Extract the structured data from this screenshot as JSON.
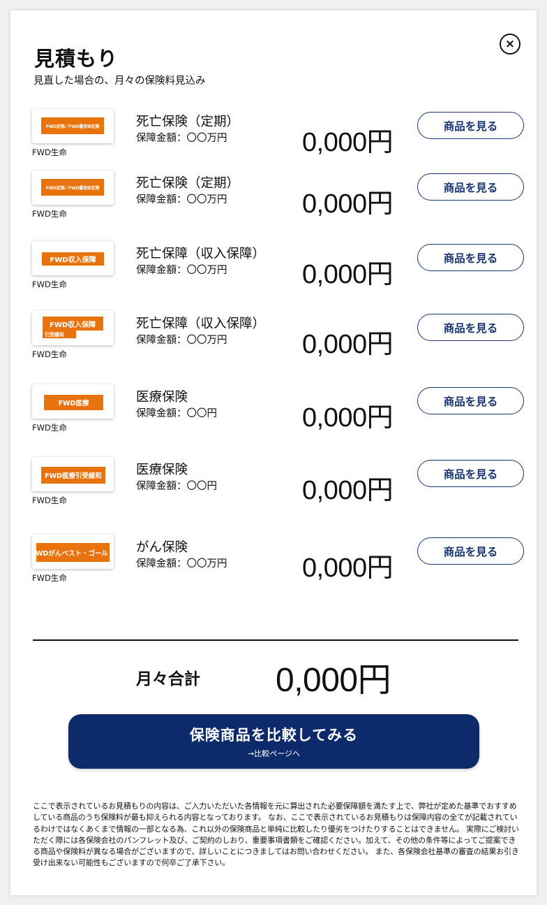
{
  "modal": {
    "title": "見積もり",
    "subtitle": "見直した場合の、月々の保険料見込み",
    "close_label": "×"
  },
  "items": [
    {
      "logo_text": "FWD定期／FWD優良体定期",
      "logo_sub": "",
      "company": "FWD生命",
      "product_name": "死亡保険（定期）",
      "coverage": "保障金額：〇〇万円",
      "price": "0,000円",
      "button_label": "商品を見る"
    },
    {
      "logo_text": "FWD定期／FWD優良体定期",
      "logo_sub": "",
      "company": "FWD生命",
      "product_name": "死亡保険（定期）",
      "coverage": "保障金額：〇〇万円",
      "price": "0,000円",
      "button_label": "商品を見る"
    },
    {
      "logo_text": "FWD収入保障",
      "logo_sub": "",
      "company": "FWD生命",
      "product_name": "死亡保障（収入保障）",
      "coverage": "保障金額：〇〇万円",
      "price": "0,000円",
      "button_label": "商品を見る"
    },
    {
      "logo_text": "FWD収入保障",
      "logo_sub": "引受緩和",
      "company": "FWD生命",
      "product_name": "死亡保障（収入保障）",
      "coverage": "保障金額：〇〇万円",
      "price": "0,000円",
      "button_label": "商品を見る"
    },
    {
      "logo_text": "FWD医療",
      "logo_sub": "",
      "company": "FWD生命",
      "product_name": "医療保険",
      "coverage": "保障金額：〇〇円",
      "price": "0,000円",
      "button_label": "商品を見る"
    },
    {
      "logo_text": "FWD医療引受緩和",
      "logo_sub": "",
      "company": "FWD生命",
      "product_name": "医療保険",
      "coverage": "保障金額：〇〇円",
      "price": "0,000円",
      "button_label": "商品を見る"
    },
    {
      "logo_text": "FWDがんベスト・ゴールド",
      "logo_sub": "",
      "company": "FWD生命",
      "product_name": "がん保険",
      "coverage": "保障金額：〇〇万円",
      "price": "0,000円",
      "button_label": "商品を見る"
    }
  ],
  "total": {
    "label": "月々合計",
    "value": "0,000円"
  },
  "compare_button": {
    "label": "保険商品を比較してみる",
    "sub_label": "→比較ページへ"
  },
  "disclaimer": "ここで表示されているお見積もりの内容は、ご入力いただいた各情報を元に算出された必要保障額を満たす上で、弊社が定めた基準でおすすめしている商品のうち保険料が最も抑えられる内容となっております。 なお、ここで表示されているお見積もりは保障内容の全てが記載されているわけではなくあくまで情報の一部となる為、これ以外の保険商品と単純に比較したり優劣をつけたりすることはできません。 実際にご検討いただく際には各保険会社のパンフレット及び、ご契約のしおり、重要事項書類をご確認ください。加えて、その他の条件等によってご提案できる商品や保険料が異なる場合がございますので、詳しいことにつきましてはお問い合わせください。 また、各保険会社基準の審査の結果お引き受け出来ない可能性もございますので何卒ご了承下さい。",
  "colors": {
    "brand_orange": "#e8720c",
    "navy": "#0d2a6b",
    "button_border": "#183570"
  }
}
